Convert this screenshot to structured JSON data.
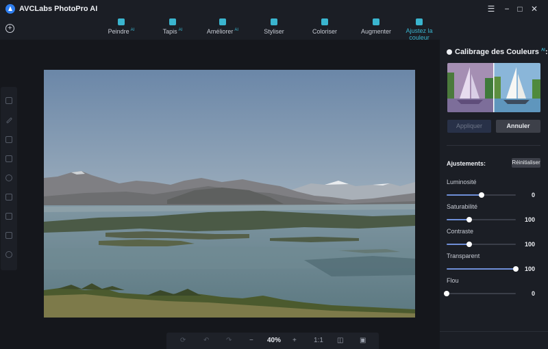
{
  "app": {
    "title": "AVCLabs PhotoPro AI"
  },
  "window": {
    "minimize": "☰",
    "min": "−",
    "max": "□",
    "close": "✕"
  },
  "toolbar": {
    "ai_badge": "AI",
    "tools": [
      {
        "label": "Peindre",
        "ai": true
      },
      {
        "label": "Tapis",
        "ai": true
      },
      {
        "label": "Améliorer",
        "ai": true
      },
      {
        "label": "Styliser",
        "ai": false
      },
      {
        "label": "Coloriser",
        "ai": false
      },
      {
        "label": "Augmenter",
        "ai": false
      },
      {
        "label": "Ajustez la couleur",
        "ai": false,
        "active": true
      }
    ]
  },
  "bottom_bar": {
    "zoom": "40%",
    "one_to_one": "1:1"
  },
  "panel": {
    "title": "Calibrage des Couleurs",
    "title_ai": "AI",
    "title_suffix": ":",
    "apply": "Appliquer",
    "cancel": "Annuler",
    "adjustments": "Ajustements:",
    "reset": "Réinitialiser",
    "sliders": [
      {
        "label": "Luminosité",
        "value": "0",
        "position": 0.5
      },
      {
        "label": "Saturabilité",
        "value": "100",
        "position": 0.33
      },
      {
        "label": "Contraste",
        "value": "100",
        "position": 0.33
      },
      {
        "label": "Transparent",
        "value": "100",
        "position": 1.0
      },
      {
        "label": "Flou",
        "value": "0",
        "position": 0.0
      }
    ]
  },
  "colors": {
    "accent": "#3ab5cf",
    "slider_fill": "#6f8fd8",
    "panel_bg": "#1b1e25"
  }
}
